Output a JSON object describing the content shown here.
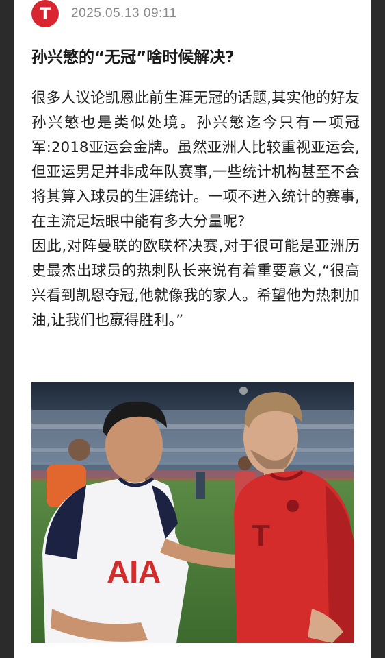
{
  "post": {
    "logo_letter": "T",
    "timestamp": "2025.05.13 09:11",
    "title": "孙兴慜的“无冠”啥时候解决?",
    "paragraph_1": "很多人议论凯恩此前生涯无冠的话题,其实他的好友孙兴慜也是类似处境。孙兴慜迄今只有一项冠军:2018亚运会金牌。虽然亚洲人比较重视亚运会,但亚运男足并非成年队赛事,一些统计机构甚至不会将其算入球员的生涯统计。一项不进入统计的赛事,在主流足坛眼中能有多大分量呢?",
    "paragraph_2": "因此,对阵曼联的欧联杯决赛,对于很可能是亚洲历史最杰出球员的热刺队长来说有着重要意义,“很高兴看到凯恩夺冠,他就像我的家人。希望他为热刺加油,让我们也赢得胜利。”"
  },
  "photo": {
    "description_icon": "photo-players-hugging",
    "shirt_left_text": "AIA",
    "colors": {
      "tottenham_shirt": "#f4f4f6",
      "tottenham_navy": "#1c2342",
      "bayern_red": "#d42b2b",
      "pitch_green": "#4c7a3a",
      "brand_red": "#d9252f"
    }
  }
}
